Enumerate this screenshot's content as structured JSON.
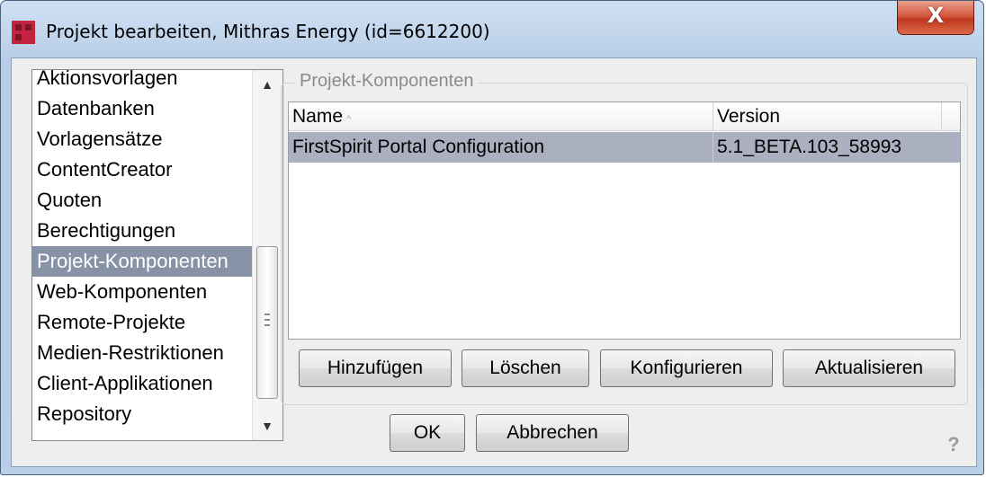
{
  "window": {
    "title": "Projekt bearbeiten, Mithras Energy (id=6612200)",
    "close_label": "X"
  },
  "sidebar": {
    "items": [
      {
        "label": "Aktionsvorlagen",
        "selected": false
      },
      {
        "label": "Datenbanken",
        "selected": false
      },
      {
        "label": "Vorlagensätze",
        "selected": false
      },
      {
        "label": "ContentCreator",
        "selected": false
      },
      {
        "label": "Quoten",
        "selected": false
      },
      {
        "label": "Berechtigungen",
        "selected": false
      },
      {
        "label": "Projekt-Komponenten",
        "selected": true
      },
      {
        "label": "Web-Komponenten",
        "selected": false
      },
      {
        "label": "Remote-Projekte",
        "selected": false
      },
      {
        "label": "Medien-Restriktionen",
        "selected": false
      },
      {
        "label": "Client-Applikationen",
        "selected": false
      },
      {
        "label": "Repository",
        "selected": false
      }
    ]
  },
  "panel": {
    "legend": "Projekt-Komponenten",
    "table": {
      "columns": [
        "Name",
        "Version"
      ],
      "sort_indicator": "^",
      "rows": [
        [
          "FirstSpirit Portal Configuration",
          "5.1_BETA.103_58993"
        ]
      ]
    },
    "buttons": {
      "add": "Hinzufügen",
      "delete": "Löschen",
      "configure": "Konfigurieren",
      "update": "Aktualisieren"
    }
  },
  "footer": {
    "ok": "OK",
    "cancel": "Abbrechen",
    "help": "?"
  },
  "colors": {
    "selection": "#8892a6",
    "row_selection": "#aab0bf",
    "close_button": "#c0391f"
  }
}
